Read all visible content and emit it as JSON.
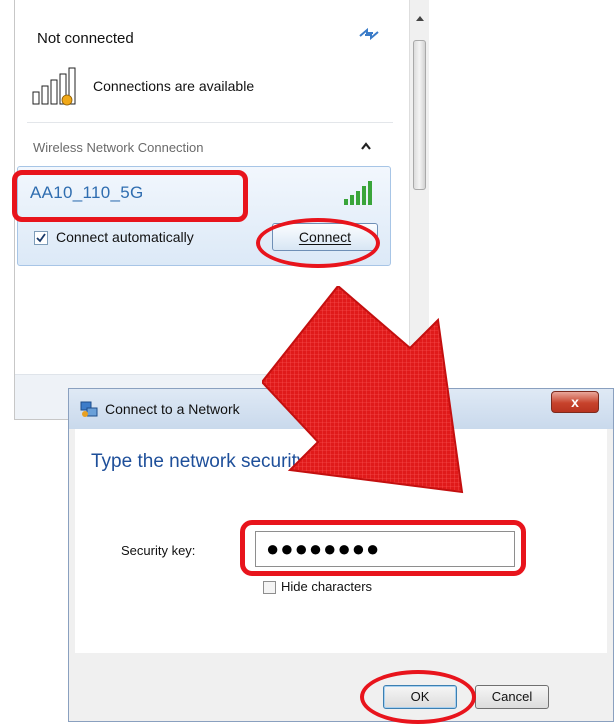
{
  "flyout": {
    "status": "Not connected",
    "availability": "Connections are available",
    "section_title": "Wireless Network Connection",
    "network": {
      "name": "AA10_110_5G",
      "auto_connect_label": "Connect automatically",
      "auto_connect_checked": true,
      "connect_button": "Connect"
    }
  },
  "dialog": {
    "title": "Connect to a Network",
    "close_label": "x",
    "heading": "Type the network security key",
    "security_key_label": "Security key:",
    "security_key_value": "●●●●●●●●",
    "hide_characters_label": "Hide characters",
    "hide_characters_checked": false,
    "ok_button": "OK",
    "cancel_button": "Cancel"
  },
  "colors": {
    "highlight": "#e8141c",
    "network_name": "#2f6db0",
    "dialog_heading": "#1e4f9a",
    "signal_green": "#3aa53a"
  },
  "icons": {
    "refresh": "refresh-icon",
    "availability": "network-available-icon",
    "collapse": "chevron-up-icon",
    "signal": "wifi-signal-icon",
    "dialog": "network-icon"
  }
}
